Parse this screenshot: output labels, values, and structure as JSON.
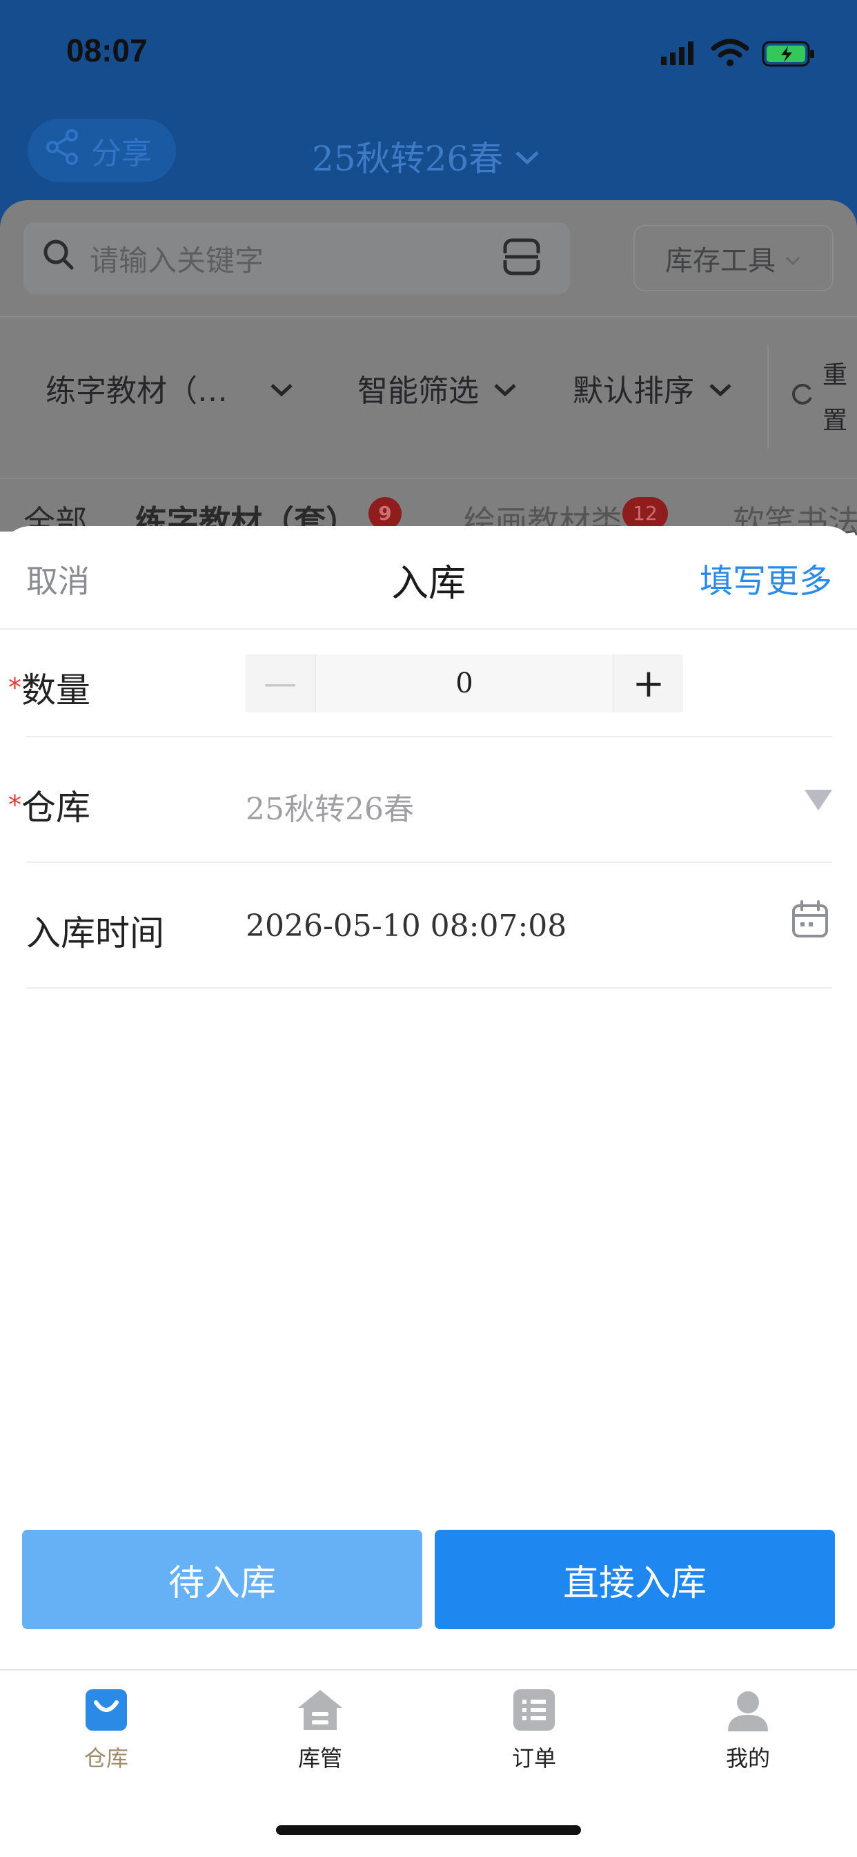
{
  "status_bar": {
    "time": "08:07"
  },
  "background": {
    "share_label": "分享",
    "season_title": "25秋转26春",
    "search_placeholder": "请输入关键字",
    "stock_tool_label": "库存工具",
    "filters": [
      "练字教材（…",
      "智能筛选",
      "默认排序"
    ],
    "reset_label": [
      "重",
      "置"
    ],
    "tabs": [
      {
        "label": "全部"
      },
      {
        "label": "练字教材（套）",
        "badge": "9"
      },
      {
        "label": "绘画教材类",
        "badge": "12"
      },
      {
        "label": "软笔书法"
      }
    ]
  },
  "sheet": {
    "cancel_label": "取消",
    "title": "入库",
    "more_label": "填写更多",
    "required_mark": "*",
    "quantity": {
      "label": "数量",
      "minus": "—",
      "value": "0",
      "plus": "+"
    },
    "warehouse": {
      "label": "仓库",
      "value": "25秋转26春"
    },
    "inbound_time": {
      "label": "入库时间",
      "value": "2026-05-10 08:07:08"
    },
    "buttons": {
      "pending": "待入库",
      "direct": "直接入库"
    }
  },
  "tabbar": {
    "items": [
      {
        "label": "仓库",
        "icon": "warehouse-bag-icon",
        "active": true
      },
      {
        "label": "库管",
        "icon": "home-icon"
      },
      {
        "label": "订单",
        "icon": "list-icon"
      },
      {
        "label": "我的",
        "icon": "user-icon"
      }
    ]
  },
  "colors": {
    "accent": "#1f87f0",
    "accent_light": "#66b1f5",
    "required": "#e03a3a",
    "link": "#2a8ae6"
  }
}
